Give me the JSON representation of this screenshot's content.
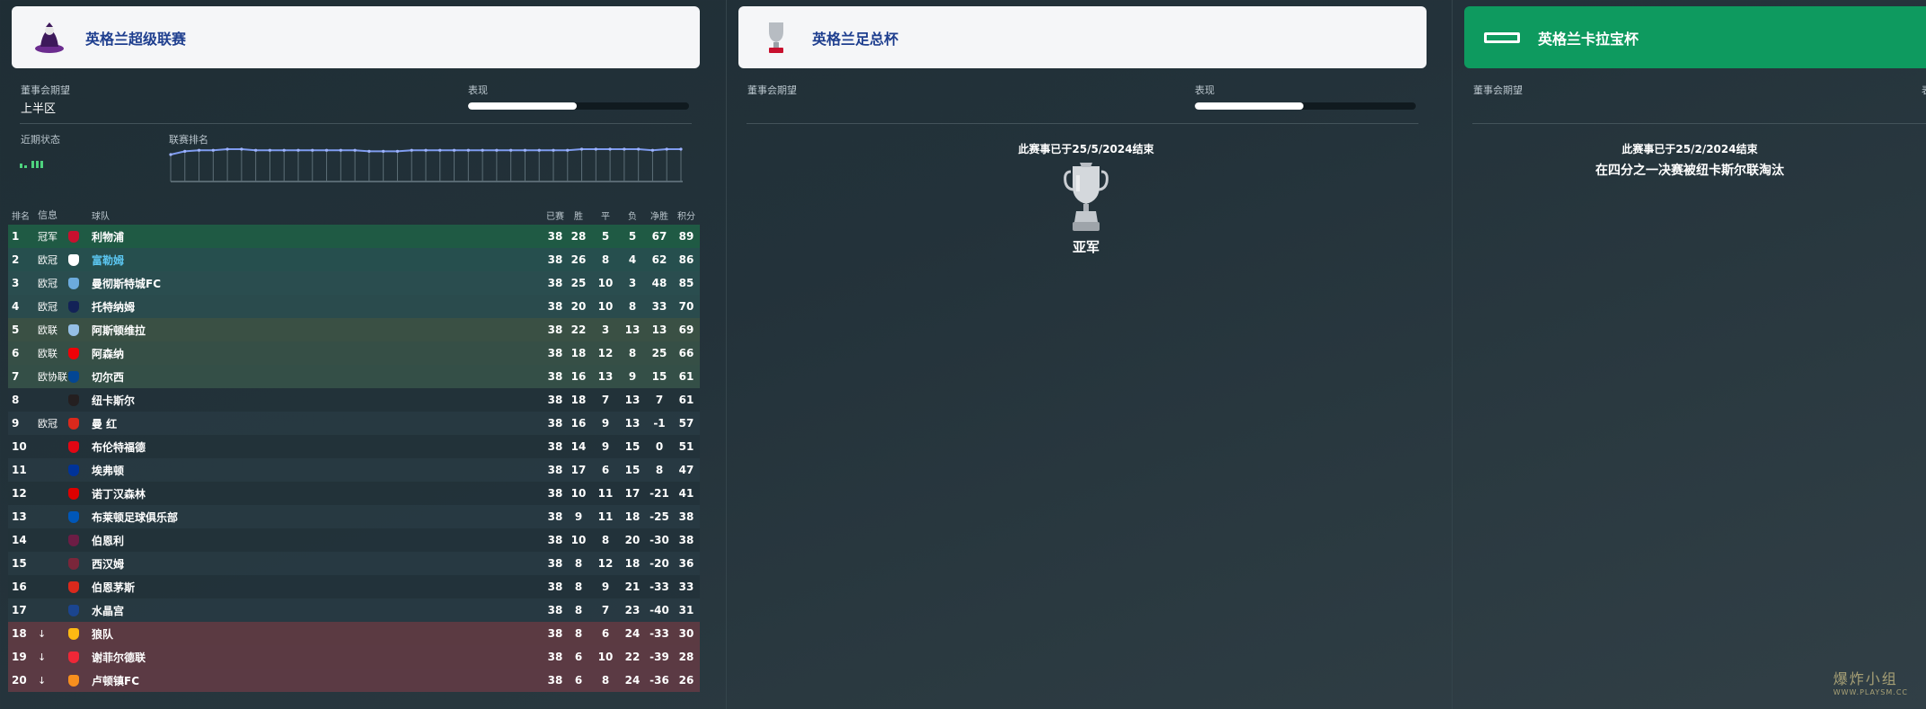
{
  "premier": {
    "title": "英格兰超级联赛",
    "board_label": "董事会期望",
    "board_value": "上半区",
    "perf_label": "表现",
    "perf_fraction": 0.49,
    "form_label": "近期状态",
    "rank_label": "联赛排名",
    "rank_history": [
      6,
      3,
      2,
      2,
      1,
      1,
      2,
      2,
      2,
      2,
      2,
      2,
      2,
      2,
      3,
      3,
      3,
      2,
      2,
      2,
      2,
      2,
      2,
      2,
      2,
      2,
      2,
      2,
      2,
      1,
      1,
      1,
      1,
      1,
      2,
      1,
      1
    ],
    "table_headers": {
      "pos": "排名",
      "info": "信息",
      "team": "球队",
      "played": "已赛",
      "won": "胜",
      "drawn": "平",
      "lost": "负",
      "gd": "净胜",
      "pts": "积分"
    },
    "rows": [
      {
        "pos": "1",
        "info": "冠军",
        "team": "利物浦",
        "p": "38",
        "w": "28",
        "d": "5",
        "l": "5",
        "gd": "67",
        "pts": "89"
      },
      {
        "pos": "2",
        "info": "欧冠",
        "team": "富勒姆",
        "p": "38",
        "w": "26",
        "d": "8",
        "l": "4",
        "gd": "62",
        "pts": "86"
      },
      {
        "pos": "3",
        "info": "欧冠",
        "team": "曼彻斯特城FC",
        "p": "38",
        "w": "25",
        "d": "10",
        "l": "3",
        "gd": "48",
        "pts": "85"
      },
      {
        "pos": "4",
        "info": "欧冠",
        "team": "托特纳姆",
        "p": "38",
        "w": "20",
        "d": "10",
        "l": "8",
        "gd": "33",
        "pts": "70"
      },
      {
        "pos": "5",
        "info": "欧联",
        "team": "阿斯顿维拉",
        "p": "38",
        "w": "22",
        "d": "3",
        "l": "13",
        "gd": "13",
        "pts": "69"
      },
      {
        "pos": "6",
        "info": "欧联",
        "team": "阿森纳",
        "p": "38",
        "w": "18",
        "d": "12",
        "l": "8",
        "gd": "25",
        "pts": "66"
      },
      {
        "pos": "7",
        "info": "欧协联",
        "team": "切尔西",
        "p": "38",
        "w": "16",
        "d": "13",
        "l": "9",
        "gd": "15",
        "pts": "61"
      },
      {
        "pos": "8",
        "info": "",
        "team": "纽卡斯尔",
        "p": "38",
        "w": "18",
        "d": "7",
        "l": "13",
        "gd": "7",
        "pts": "61"
      },
      {
        "pos": "9",
        "info": "欧冠",
        "team": "曼 红",
        "p": "38",
        "w": "16",
        "d": "9",
        "l": "13",
        "gd": "-1",
        "pts": "57"
      },
      {
        "pos": "10",
        "info": "",
        "team": "布伦特福德",
        "p": "38",
        "w": "14",
        "d": "9",
        "l": "15",
        "gd": "0",
        "pts": "51"
      },
      {
        "pos": "11",
        "info": "",
        "team": "埃弗顿",
        "p": "38",
        "w": "17",
        "d": "6",
        "l": "15",
        "gd": "8",
        "pts": "47"
      },
      {
        "pos": "12",
        "info": "",
        "team": "诺丁汉森林",
        "p": "38",
        "w": "10",
        "d": "11",
        "l": "17",
        "gd": "-21",
        "pts": "41"
      },
      {
        "pos": "13",
        "info": "",
        "team": "布莱顿足球俱乐部",
        "p": "38",
        "w": "9",
        "d": "11",
        "l": "18",
        "gd": "-25",
        "pts": "38"
      },
      {
        "pos": "14",
        "info": "",
        "team": "伯恩利",
        "p": "38",
        "w": "10",
        "d": "8",
        "l": "20",
        "gd": "-30",
        "pts": "38"
      },
      {
        "pos": "15",
        "info": "",
        "team": "西汉姆",
        "p": "38",
        "w": "8",
        "d": "12",
        "l": "18",
        "gd": "-20",
        "pts": "36"
      },
      {
        "pos": "16",
        "info": "",
        "team": "伯恩茅斯",
        "p": "38",
        "w": "8",
        "d": "9",
        "l": "21",
        "gd": "-33",
        "pts": "33"
      },
      {
        "pos": "17",
        "info": "",
        "team": "水晶宫",
        "p": "38",
        "w": "8",
        "d": "7",
        "l": "23",
        "gd": "-40",
        "pts": "31"
      },
      {
        "pos": "18",
        "info": "↓",
        "team": "狼队",
        "p": "38",
        "w": "8",
        "d": "6",
        "l": "24",
        "gd": "-33",
        "pts": "30"
      },
      {
        "pos": "19",
        "info": "↓",
        "team": "谢菲尔德联",
        "p": "38",
        "w": "6",
        "d": "10",
        "l": "22",
        "gd": "-39",
        "pts": "28"
      },
      {
        "pos": "20",
        "info": "↓",
        "team": "卢顿镇FC",
        "p": "38",
        "w": "6",
        "d": "8",
        "l": "24",
        "gd": "-36",
        "pts": "26"
      }
    ],
    "row_tints": [
      "#1f5a44",
      "#264f4e",
      "#2a4d4f",
      "#2a4b4d",
      "#3a5044",
      "#364f46",
      "#344f47",
      "",
      "",
      "",
      "",
      "",
      "",
      "",
      "",
      "",
      "",
      "#5b3a42",
      "#5b3a43",
      "#5b3a44"
    ],
    "badge_colors": [
      "#c8102e",
      "#ffffff",
      "#6cabdd",
      "#132257",
      "#95bfe5",
      "#ef0107",
      "#034694",
      "#241f20",
      "#da291c",
      "#e30613",
      "#003399",
      "#dd0000",
      "#0057b8",
      "#6c1d45",
      "#7a263a",
      "#da291c",
      "#1b458f",
      "#fdb913",
      "#ee2737",
      "#f78f1e"
    ],
    "highlight_row": 2
  },
  "facup": {
    "title": "英格兰足总杯",
    "board_label": "董事会期望",
    "perf_label": "表现",
    "perf_fraction": 0.49,
    "ended_text": "此赛事已于25/5/2024结束",
    "result": "亚军"
  },
  "carabao": {
    "title": "英格兰卡拉宝杯",
    "board_label": "董事会期望",
    "perf_label": "表",
    "ended_text": "此赛事已于25/2/2024结束",
    "outcome": "在四分之一决赛被纽卡斯尔联淘汰"
  },
  "watermark": {
    "text": "爆炸小组",
    "sub": "WWW.PLAYSM.CC"
  }
}
